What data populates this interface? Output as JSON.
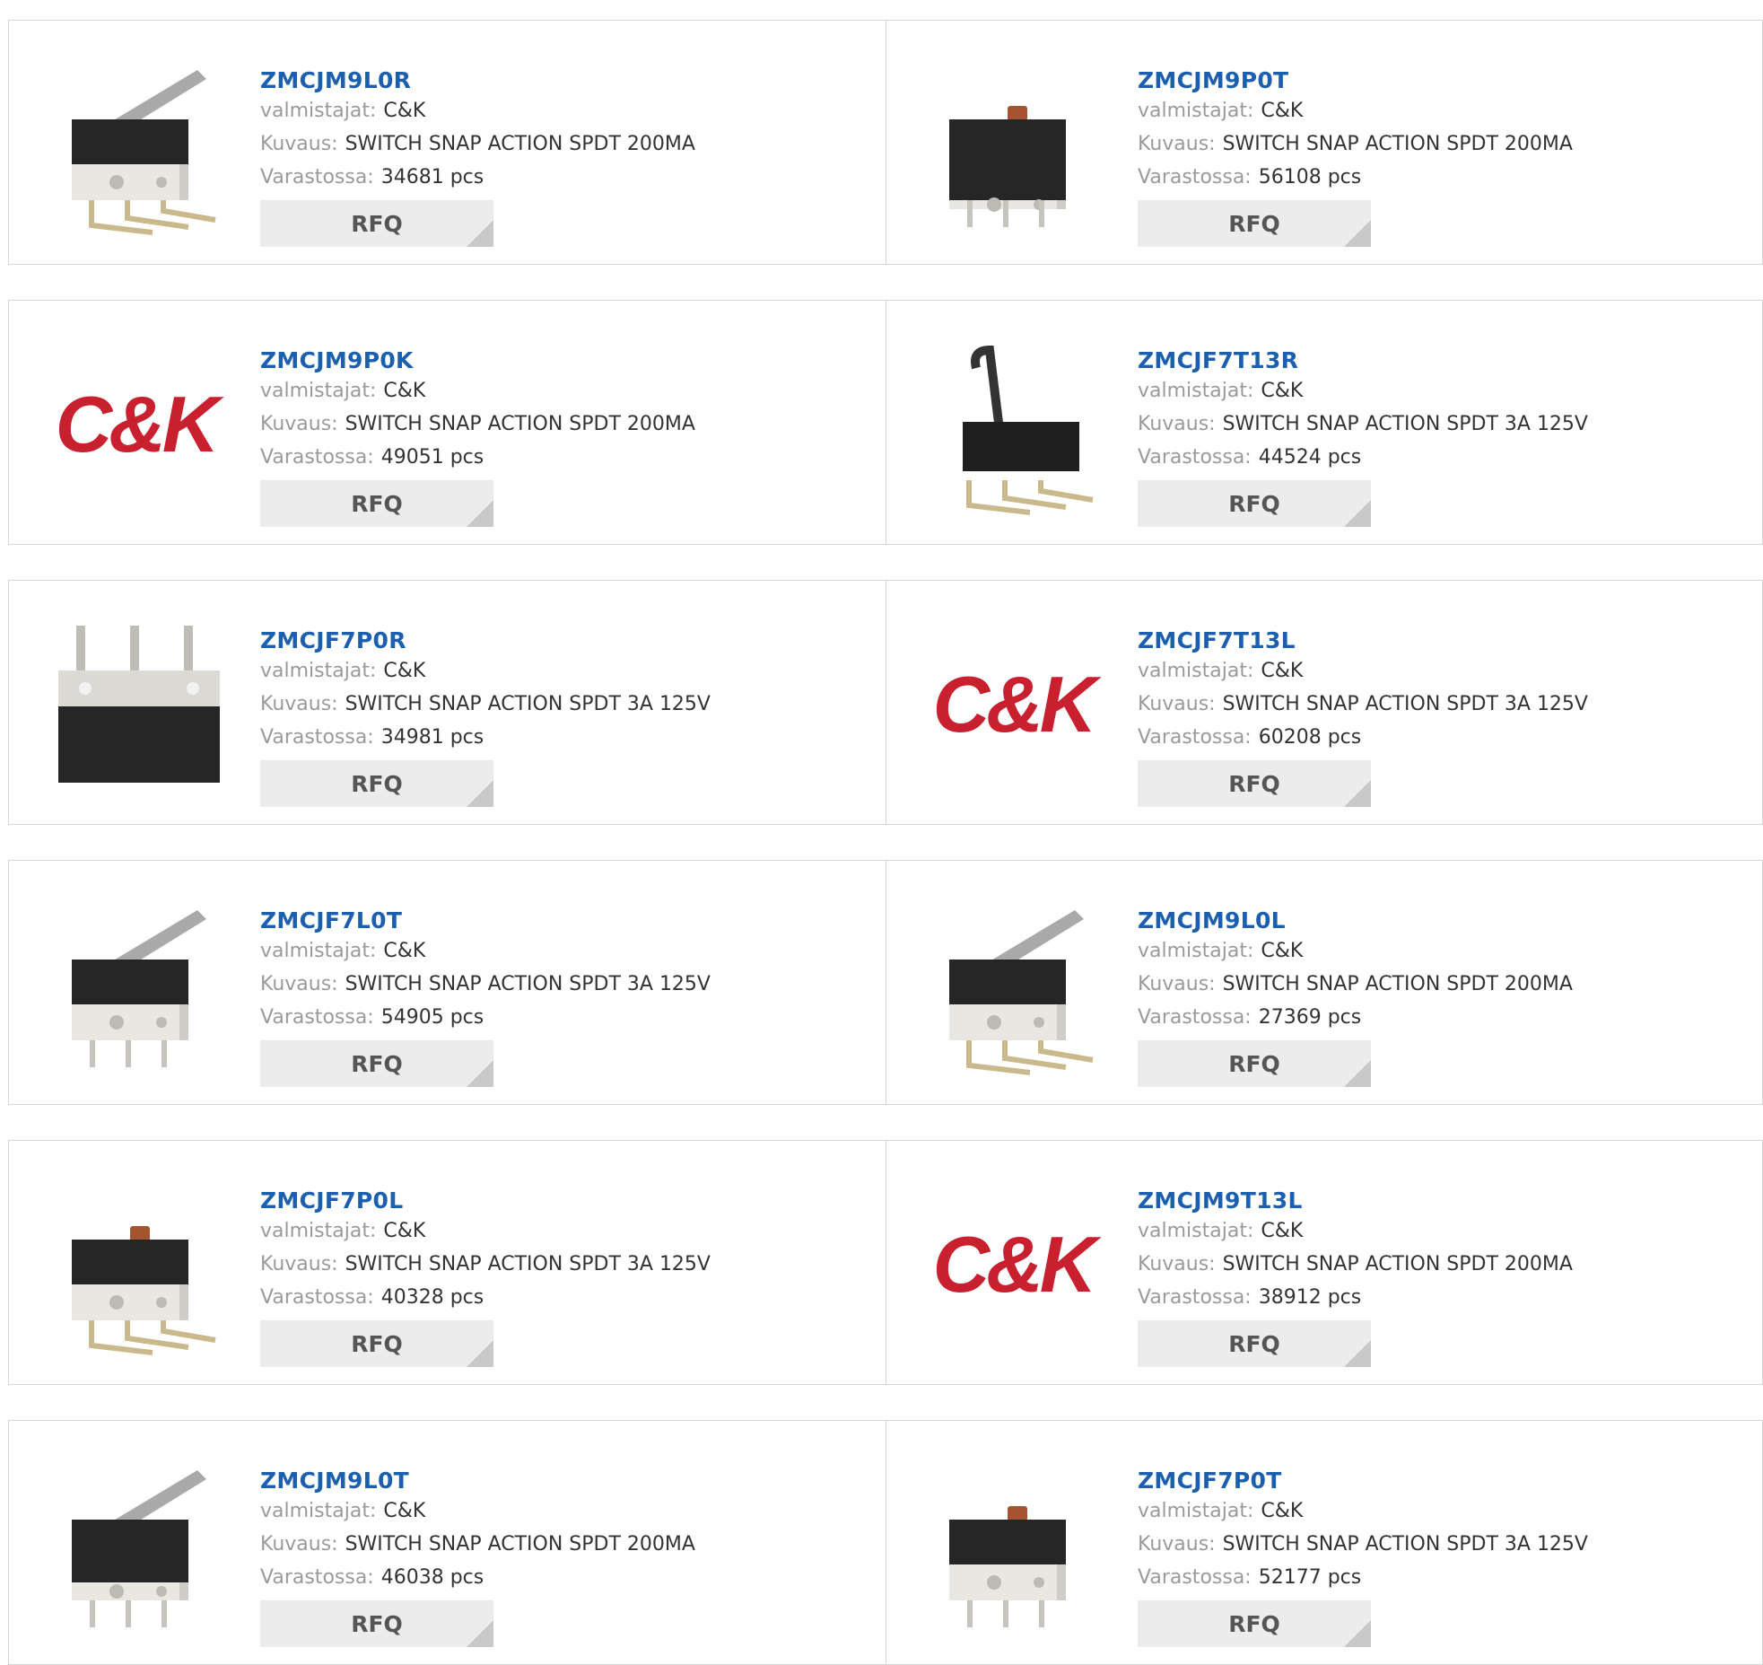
{
  "labels": {
    "manufacturer": "valmistajat:",
    "description": "Kuvaus:",
    "stock": "Varastossa:",
    "rfq": "RFQ"
  },
  "products": [
    {
      "part": "ZMCJM9L0R",
      "manufacturer": "C&K",
      "description": "SWITCH SNAP ACTION SPDT 200MA",
      "stock": "34681 pcs",
      "image": "lever-switch-right-angle"
    },
    {
      "part": "ZMCJM9P0T",
      "manufacturer": "C&K",
      "description": "SWITCH SNAP ACTION SPDT 200MA",
      "stock": "56108 pcs",
      "image": "pin-plunger-switch-black"
    },
    {
      "part": "ZMCJM9P0K",
      "manufacturer": "C&K",
      "description": "SWITCH SNAP ACTION SPDT 200MA",
      "stock": "49051 pcs",
      "image": "ck-logo"
    },
    {
      "part": "ZMCJF7T13R",
      "manufacturer": "C&K",
      "description": "SWITCH SNAP ACTION SPDT 3A 125V",
      "stock": "44524 pcs",
      "image": "hooked-lever-switch"
    },
    {
      "part": "ZMCJF7P0R",
      "manufacturer": "C&K",
      "description": "SWITCH SNAP ACTION SPDT 3A 125V",
      "stock": "34981 pcs",
      "image": "switch-pins-up"
    },
    {
      "part": "ZMCJF7T13L",
      "manufacturer": "C&K",
      "description": "SWITCH SNAP ACTION SPDT 3A 125V",
      "stock": "60208 pcs",
      "image": "ck-logo"
    },
    {
      "part": "ZMCJF7L0T",
      "manufacturer": "C&K",
      "description": "SWITCH SNAP ACTION SPDT 3A 125V",
      "stock": "54905 pcs",
      "image": "lever-switch"
    },
    {
      "part": "ZMCJM9L0L",
      "manufacturer": "C&K",
      "description": "SWITCH SNAP ACTION SPDT 200MA",
      "stock": "27369 pcs",
      "image": "lever-switch-right-angle"
    },
    {
      "part": "ZMCJF7P0L",
      "manufacturer": "C&K",
      "description": "SWITCH SNAP ACTION SPDT 3A 125V",
      "stock": "40328 pcs",
      "image": "pin-plunger-switch-right-angle"
    },
    {
      "part": "ZMCJM9T13L",
      "manufacturer": "C&K",
      "description": "SWITCH SNAP ACTION SPDT 200MA",
      "stock": "38912 pcs",
      "image": "ck-logo"
    },
    {
      "part": "ZMCJM9L0T",
      "manufacturer": "C&K",
      "description": "SWITCH SNAP ACTION SPDT 200MA",
      "stock": "46038 pcs",
      "image": "lever-switch-black"
    },
    {
      "part": "ZMCJF7P0T",
      "manufacturer": "C&K",
      "description": "SWITCH SNAP ACTION SPDT 3A 125V",
      "stock": "52177 pcs",
      "image": "pin-plunger-switch"
    }
  ],
  "colors": {
    "link": "#1b5fae",
    "label": "#9a9a9a",
    "value": "#333333",
    "border": "#d5d5d5",
    "button_bg": "#ececec",
    "logo_red": "#c8202f"
  }
}
